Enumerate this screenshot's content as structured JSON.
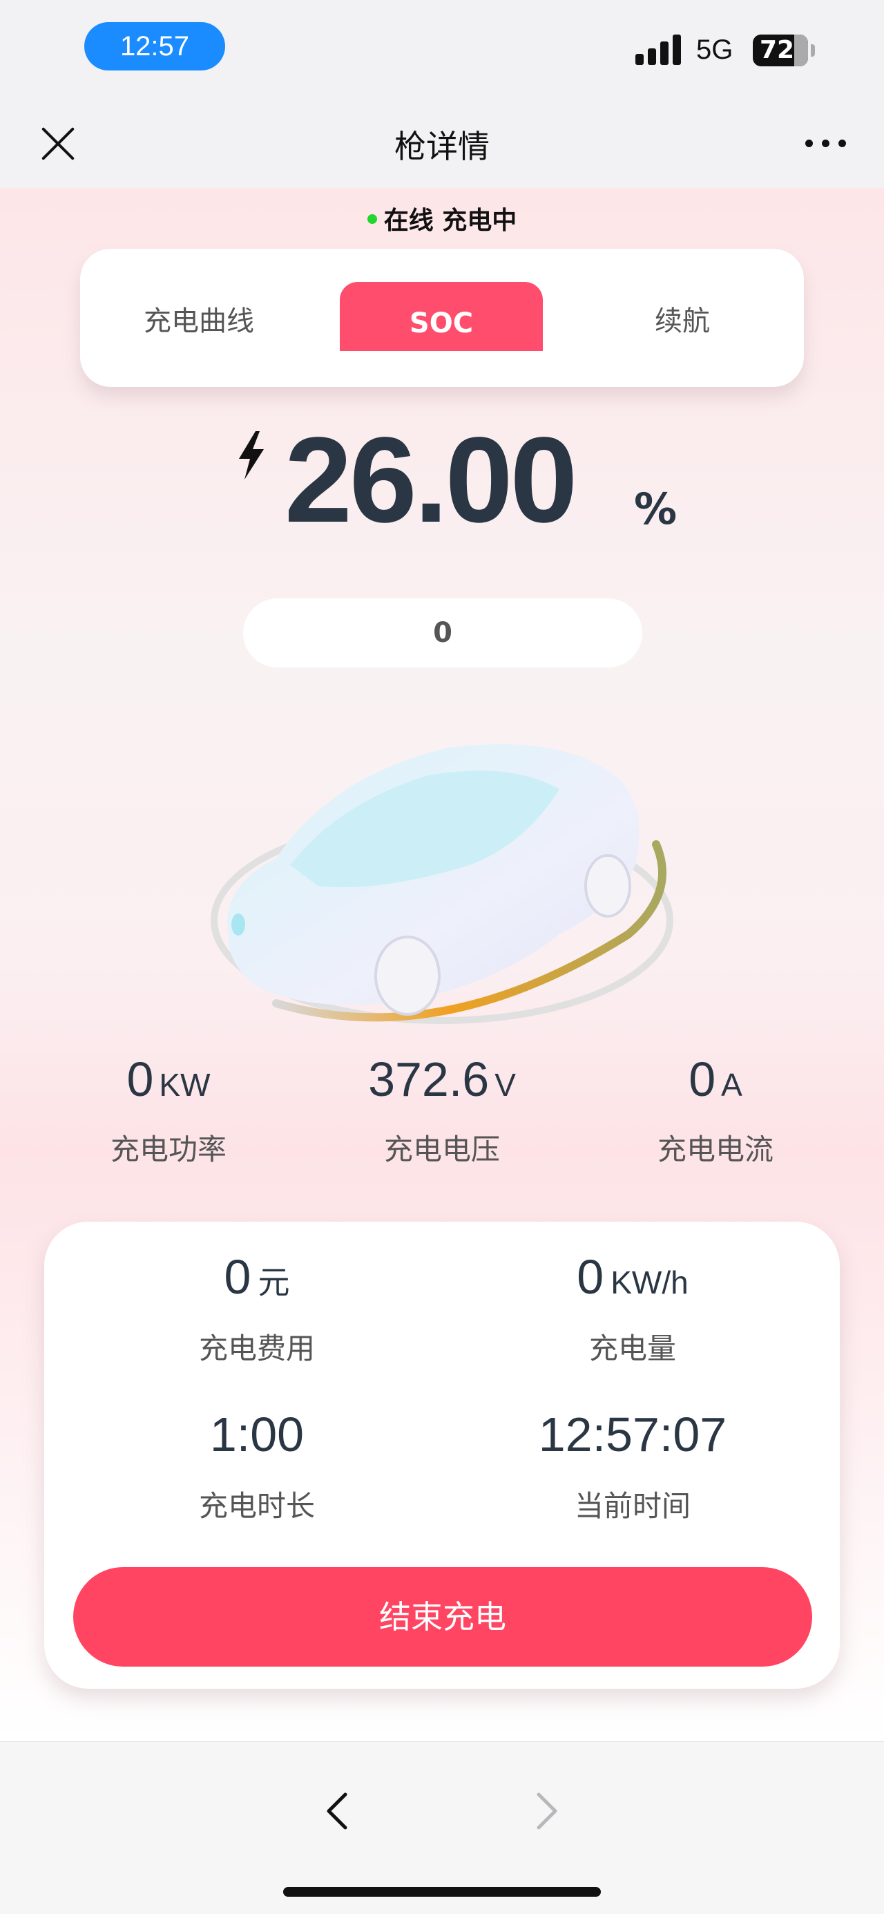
{
  "status_bar": {
    "time": "12:57",
    "network": "5G",
    "battery": "72"
  },
  "nav": {
    "title": "枪详情",
    "close_icon": "close-icon",
    "more_icon": "more-icon"
  },
  "status": {
    "text": "在线 充电中",
    "dot_color": "#22d62c"
  },
  "tabs": [
    {
      "label": "充电曲线"
    },
    {
      "label": "SOC",
      "active": true
    },
    {
      "label": "续航"
    }
  ],
  "soc": {
    "value": "26.00",
    "unit": "%",
    "icon": "lightning-bolt-icon",
    "sub_value": "0"
  },
  "charge_ring_progress": 0.26,
  "metrics": [
    {
      "value": "0",
      "unit": "KW",
      "label": "充电功率"
    },
    {
      "value": "372.6",
      "unit": "V",
      "label": "充电电压"
    },
    {
      "value": "0",
      "unit": "A",
      "label": "充电电流"
    }
  ],
  "card": {
    "cost": {
      "value": "0",
      "unit": "元",
      "label": "充电费用"
    },
    "energy": {
      "value": "0",
      "unit": "KW/h",
      "label": "充电量"
    },
    "duration": {
      "value": "1:00",
      "label": "充电时长"
    },
    "current_time": {
      "value": "12:57:07",
      "label": "当前时间"
    },
    "stop_button": "结束充电"
  },
  "toolbar": {
    "back_icon": "chevron-left-icon",
    "forward_icon": "chevron-right-icon"
  },
  "colors": {
    "accent": "#ff4562",
    "tab_active": "#ff4d6d",
    "text_dark": "#2a3644",
    "status_online": "#22d62c"
  }
}
